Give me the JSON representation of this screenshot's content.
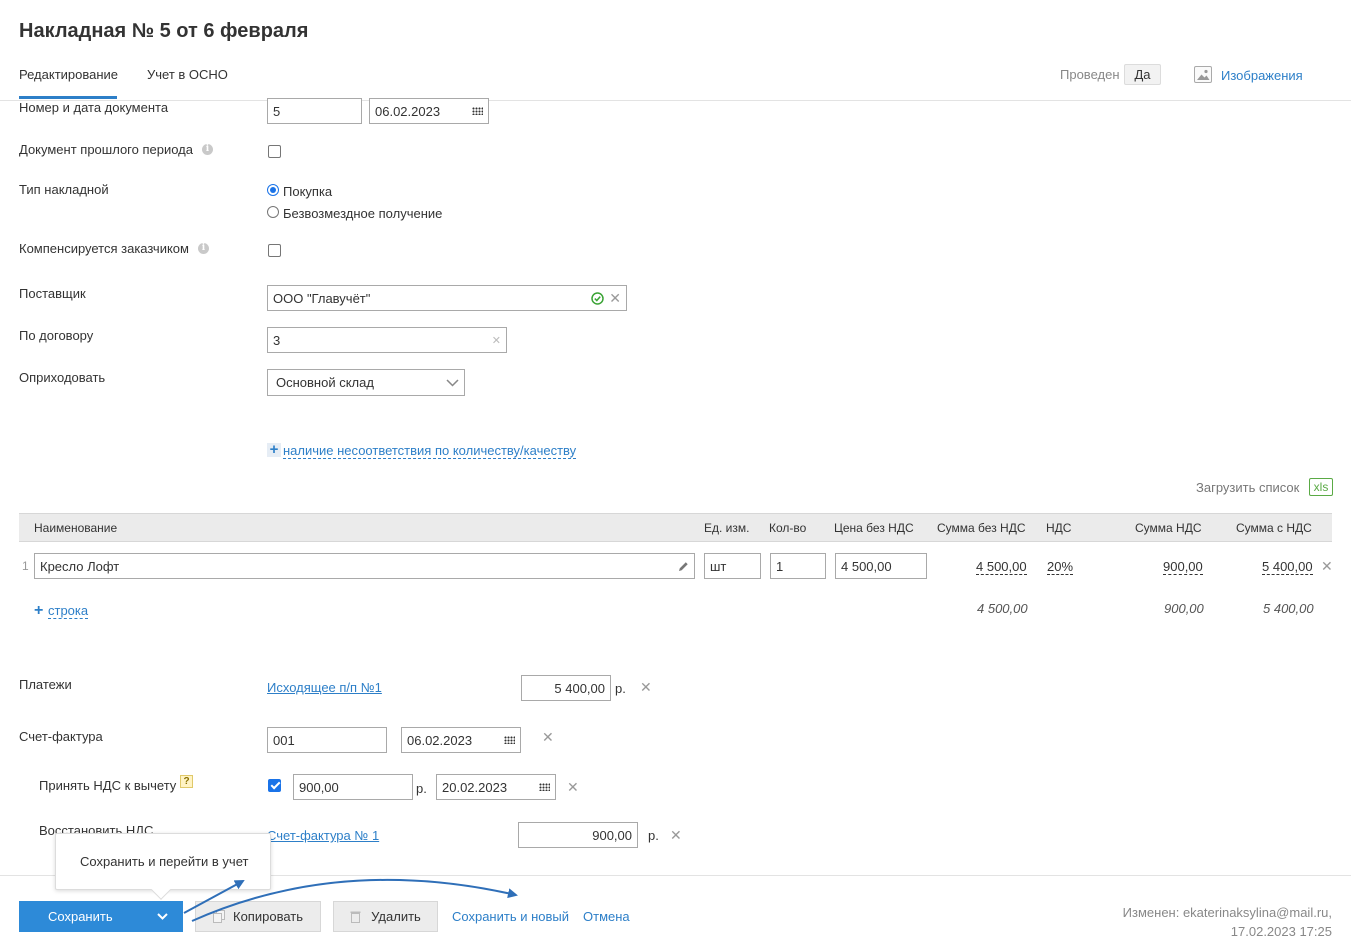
{
  "header": {
    "title": "Накладная № 5 от 6 февраля",
    "tabs": [
      {
        "label": "Редактирование"
      },
      {
        "label": "Учет в ОСНО"
      }
    ],
    "posted_label": "Проведен",
    "posted_value": "Да",
    "images_label": "Изображения"
  },
  "form": {
    "doc_number_label": "Номер и дата документа",
    "doc_number": "5",
    "doc_date": "06.02.2023",
    "past_period_label": "Документ прошлого периода",
    "invoice_type_label": "Тип накладной",
    "invoice_type_options": [
      "Покупка",
      "Безвозмездное получение"
    ],
    "compensated_label": "Компенсируется заказчиком",
    "supplier_label": "Поставщик",
    "supplier_value": "ООО \"Главучёт\"",
    "contract_label": "По договору",
    "contract_value": "3",
    "receive_label": "Оприходовать",
    "receive_value": "Основной склад",
    "discrepancy_link": "наличие несоответствия по количеству/качеству",
    "upload_list_label": "Загрузить список",
    "xls_label": "xls"
  },
  "table": {
    "headers": [
      "Наименование",
      "Ед. изм.",
      "Кол-во",
      "Цена без НДС",
      "Сумма без НДС",
      "НДС",
      "Сумма НДС",
      "Сумма с НДС"
    ],
    "rows": [
      {
        "index": "1",
        "name": "Кресло Лофт",
        "unit": "шт",
        "qty": "1",
        "price": "4 500,00",
        "sum_no_vat": "4 500,00",
        "vat_rate": "20%",
        "vat_sum": "900,00",
        "sum_with_vat": "5 400,00"
      }
    ],
    "add_row_label": "строка",
    "totals": {
      "sum_no_vat": "4 500,00",
      "vat_sum": "900,00",
      "sum_with_vat": "5 400,00"
    }
  },
  "payments": {
    "label": "Платежи",
    "link": "Исходящее п/п №1",
    "amount": "5 400,00",
    "currency": "р."
  },
  "invoice": {
    "label": "Счет-фактура",
    "number": "001",
    "date": "06.02.2023",
    "accept_vat_label": "Принять НДС к вычету",
    "accept_vat_help": "?",
    "accept_vat_amount": "900,00",
    "accept_vat_currency": "р.",
    "accept_vat_date": "20.02.2023",
    "restore_vat_label": "Восстановить НДС",
    "restore_link": "Счет-фактура № 1",
    "restore_amount": "900,00",
    "restore_currency": "р."
  },
  "footer": {
    "tooltip": "Сохранить и перейти в учет",
    "save_label": "Сохранить",
    "copy_label": "Копировать",
    "delete_label": "Удалить",
    "save_new_label": "Сохранить и новый",
    "cancel_label": "Отмена",
    "changed_by": "Изменен: ekaterinaksylina@mail.ru,",
    "changed_at": "17.02.2023 17:25"
  },
  "colors": {
    "accent": "#2d7fc8",
    "primary_button": "#2d8ad8",
    "ok_green": "#3aa335",
    "annotation_arrow": "#2f6fb8"
  }
}
